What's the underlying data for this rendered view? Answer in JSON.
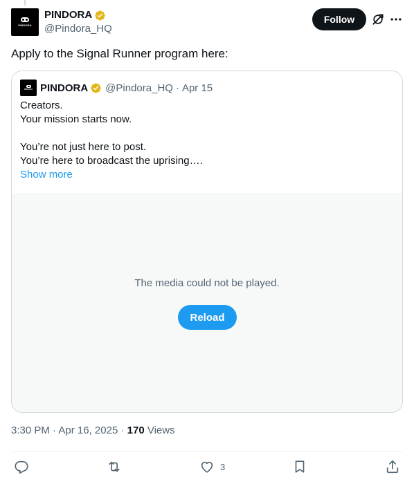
{
  "author": {
    "display_name": "PINDORA",
    "handle": "@Pindora_HQ",
    "avatar_text": "PINDORA"
  },
  "header": {
    "follow_label": "Follow"
  },
  "tweet": {
    "text": "Apply to the Signal Runner program here:"
  },
  "quote": {
    "display_name": "PINDORA",
    "handle": "@Pindora_HQ",
    "separator": "·",
    "date": "Apr 15",
    "lines": [
      "Creators.",
      "Your mission starts now.",
      "",
      "You’re not just here to post.",
      "You’re here to broadcast the uprising…."
    ],
    "show_more_label": "Show more",
    "media": {
      "error_message": "The media could not be played.",
      "reload_label": "Reload"
    }
  },
  "meta": {
    "time": "3:30 PM",
    "date": "Apr 16, 2025",
    "separator": "·",
    "views_count": "170",
    "views_label": "Views"
  },
  "actions": {
    "reply": {
      "icon": "reply-icon",
      "count": ""
    },
    "repost": {
      "icon": "repost-icon",
      "count": ""
    },
    "like": {
      "icon": "heart-icon",
      "count": "3"
    },
    "bookmark": {
      "icon": "bookmark-icon",
      "count": ""
    },
    "share": {
      "icon": "share-icon",
      "count": ""
    }
  },
  "colors": {
    "text": "#0f1419",
    "secondary": "#536471",
    "accent": "#1d9bf0",
    "verified_gold": "#e2b719",
    "border": "#cfd9de"
  }
}
